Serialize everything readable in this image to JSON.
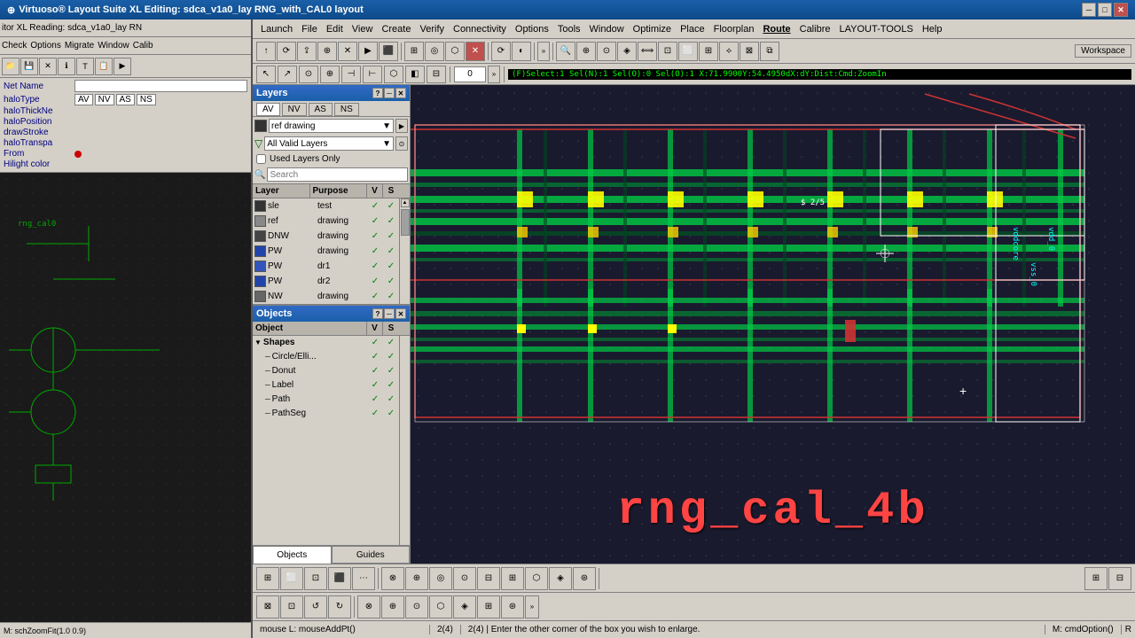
{
  "titlebar": {
    "text": "Virtuoso® Layout Suite XL Editing: sdca_v1a0_lay RNG_with_CAL0 layout"
  },
  "left_titlebar": {
    "text": "itor XL Reading: sdca_v1a0_lay RN"
  },
  "menubar": {
    "items": [
      "Launch",
      "File",
      "Edit",
      "View",
      "Create",
      "Verify",
      "Connectivity",
      "Options",
      "Tools",
      "Window",
      "Optimize",
      "Place",
      "Floorplan",
      "Route",
      "Calibre",
      "LAYOUT-TOOLS",
      "Help"
    ]
  },
  "left_menubar": {
    "items": [
      "itor XL Reading: sdca_v1a0_lay RN",
      "Check",
      "Options",
      "Migrate",
      "Window",
      "Calib"
    ]
  },
  "properties": {
    "net_name": "Net Name",
    "haloType": "haloType",
    "haloThickness": "haloThickNe",
    "haloPosition": "haloPosition",
    "drawStroke": "drawStroke",
    "haloTransparency": "haloTranspa",
    "from": "From",
    "hilight_color": "Hilight color"
  },
  "layers_panel": {
    "title": "Layers",
    "tabs": [
      "AV",
      "NV",
      "AS",
      "NS"
    ],
    "layer_dropdown": "ref drawing",
    "filter_dropdown": "All Valid Layers",
    "checkbox_label": "Used Layers Only",
    "search_placeholder": "Search",
    "headers": [
      "Layer",
      "Purpose",
      "V",
      "S"
    ],
    "rows": [
      {
        "color": "#333",
        "name": "sle",
        "purpose": "test",
        "v": true,
        "s": true
      },
      {
        "color": "#888",
        "name": "ref",
        "purpose": "drawing",
        "v": true,
        "s": true
      },
      {
        "color": "#444",
        "name": "DNW",
        "purpose": "drawing",
        "v": true,
        "s": true
      },
      {
        "color": "#2244aa",
        "name": "PW",
        "purpose": "drawing",
        "v": true,
        "s": true
      },
      {
        "color": "#2244aa",
        "name": "PW",
        "purpose": "dr1",
        "v": true,
        "s": true
      },
      {
        "color": "#2244aa",
        "name": "PW",
        "purpose": "dr2",
        "v": true,
        "s": true
      },
      {
        "color": "#666",
        "name": "NW",
        "purpose": "drawing",
        "v": true,
        "s": true
      }
    ]
  },
  "objects_panel": {
    "title": "Objects",
    "headers": [
      "Object",
      "V",
      "S"
    ],
    "rows": [
      {
        "name": "Shapes",
        "indent": 0,
        "expanded": true,
        "v": true,
        "s": true
      },
      {
        "name": "Circle/Elli...",
        "indent": 1,
        "v": true,
        "s": true
      },
      {
        "name": "Donut",
        "indent": 1,
        "v": true,
        "s": true
      },
      {
        "name": "Label",
        "indent": 1,
        "v": true,
        "s": true
      },
      {
        "name": "Path",
        "indent": 1,
        "v": true,
        "s": true
      },
      {
        "name": "PathSeg",
        "indent": 1,
        "v": true,
        "s": true
      }
    ],
    "tabs": [
      "Objects",
      "Guides"
    ]
  },
  "toolbar2": {
    "coord_display": "(F)Select:1 Sel(N):1 Sel(O):0 Sel(O):1 X:71.9900Y:54.4950dX:dY:Dist:Cmd:ZoomIn"
  },
  "workspace": {
    "label": "Workspace"
  },
  "statusbar": {
    "left": "M: schZoomFit(1.0 0.9)",
    "right": "M: cmdOption()",
    "bottom_left": "mouse L: mouseAddPt()",
    "prompt": "2(4) |  Enter the other corner of the box you wish to enlarge.",
    "zoom_input": "0"
  },
  "canvas": {
    "big_label": "rng_cal_4b",
    "label_color": "#ff4444"
  },
  "icons": {
    "minimize": "─",
    "maximize": "□",
    "close": "✕",
    "dropdown_arrow": "▼",
    "filter": "▽",
    "search": "🔍",
    "check": "✓",
    "expand": "─",
    "collapse": "▶"
  }
}
